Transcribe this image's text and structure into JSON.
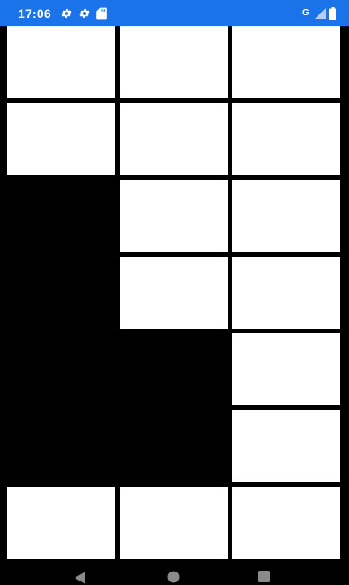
{
  "status_bar": {
    "time": "17:06",
    "background": "#1a73e8",
    "network_label": "G",
    "icons": [
      "settings-icon",
      "settings-icon",
      "sd-card-icon",
      "signal-icon",
      "battery-icon"
    ]
  },
  "grid": {
    "columns": 3,
    "rows": 7,
    "tile_color": "#ffffff",
    "empty_color": "#000000",
    "cells": [
      {
        "row": 1,
        "col": 1,
        "filled": true
      },
      {
        "row": 1,
        "col": 2,
        "filled": true
      },
      {
        "row": 1,
        "col": 3,
        "filled": true
      },
      {
        "row": 2,
        "col": 1,
        "filled": true
      },
      {
        "row": 2,
        "col": 2,
        "filled": true
      },
      {
        "row": 2,
        "col": 3,
        "filled": true
      },
      {
        "row": 3,
        "col": 1,
        "filled": false
      },
      {
        "row": 3,
        "col": 2,
        "filled": true
      },
      {
        "row": 3,
        "col": 3,
        "filled": true
      },
      {
        "row": 4,
        "col": 1,
        "filled": false
      },
      {
        "row": 4,
        "col": 2,
        "filled": true
      },
      {
        "row": 4,
        "col": 3,
        "filled": true
      },
      {
        "row": 5,
        "col": 1,
        "filled": false
      },
      {
        "row": 5,
        "col": 2,
        "filled": false
      },
      {
        "row": 5,
        "col": 3,
        "filled": true
      },
      {
        "row": 6,
        "col": 1,
        "filled": false
      },
      {
        "row": 6,
        "col": 2,
        "filled": false
      },
      {
        "row": 6,
        "col": 3,
        "filled": true
      },
      {
        "row": 7,
        "col": 1,
        "filled": true
      },
      {
        "row": 7,
        "col": 2,
        "filled": true
      },
      {
        "row": 7,
        "col": 3,
        "filled": true
      }
    ]
  },
  "nav_bar": {
    "buttons": [
      "back-icon",
      "home-icon",
      "recents-icon"
    ]
  }
}
